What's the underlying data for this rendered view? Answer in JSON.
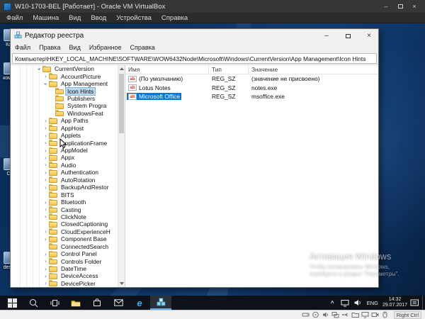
{
  "vbox": {
    "title": "W10-1703-BEL [Работает] - Oracle VM VirtualBox",
    "menu": [
      "Файл",
      "Машина",
      "Вид",
      "Ввод",
      "Устройства",
      "Справка"
    ],
    "status": {
      "hint": "Right Ctrl",
      "icons": [
        "hdd",
        "optical",
        "audio",
        "network",
        "usb",
        "shared-folders",
        "display",
        "recording",
        "mouse-integration"
      ]
    }
  },
  "desktop": {
    "icons": [
      {
        "label": "Ко..."
      },
      {
        "label": "комп..."
      },
      {
        "label": "С..."
      },
      {
        "label": "desk..."
      }
    ]
  },
  "watermark": {
    "title": "Активация Windows",
    "line1": "Чтобы активировать Windows,",
    "line2": "перейдите в раздел \"Параметры\"."
  },
  "regedit": {
    "title": "Редактор реестра",
    "menu": [
      "Файл",
      "Правка",
      "Вид",
      "Избранное",
      "Справка"
    ],
    "address": "Компьютер\\HKEY_LOCAL_MACHINE\\SOFTWARE\\WOW6432Node\\Microsoft\\Windows\\CurrentVersion\\App Management\\Icon Hints",
    "columns": [
      "Имя",
      "Тип",
      "Значение"
    ],
    "tree": [
      {
        "label": "CurrentVersion",
        "indent": 4,
        "state": "expanded",
        "selected": false
      },
      {
        "label": "AccountPicture",
        "indent": 5,
        "state": "collapsed",
        "selected": false
      },
      {
        "label": "App Management",
        "indent": 5,
        "state": "expanded",
        "selected": false
      },
      {
        "label": "Icon Hints",
        "indent": 6,
        "state": "leaf",
        "selected": true
      },
      {
        "label": "Publishers",
        "indent": 6,
        "state": "leaf",
        "selected": false
      },
      {
        "label": "System Progra",
        "indent": 6,
        "state": "leaf",
        "selected": false
      },
      {
        "label": "WindowsFeat",
        "indent": 6,
        "state": "leaf",
        "selected": false
      },
      {
        "label": "App Paths",
        "indent": 5,
        "state": "collapsed",
        "selected": false
      },
      {
        "label": "AppHost",
        "indent": 5,
        "state": "collapsed",
        "selected": false
      },
      {
        "label": "Applets",
        "indent": 5,
        "state": "collapsed",
        "selected": false
      },
      {
        "label": "ApplicationFrame",
        "indent": 5,
        "state": "collapsed",
        "selected": false
      },
      {
        "label": "AppModel",
        "indent": 5,
        "state": "collapsed",
        "selected": false
      },
      {
        "label": "Appx",
        "indent": 5,
        "state": "collapsed",
        "selected": false
      },
      {
        "label": "Audio",
        "indent": 5,
        "state": "collapsed",
        "selected": false
      },
      {
        "label": "Authentication",
        "indent": 5,
        "state": "collapsed",
        "selected": false
      },
      {
        "label": "AutoRotation",
        "indent": 5,
        "state": "collapsed",
        "selected": false
      },
      {
        "label": "BackupAndRestor",
        "indent": 5,
        "state": "collapsed",
        "selected": false
      },
      {
        "label": "BITS",
        "indent": 5,
        "state": "leaf",
        "selected": false
      },
      {
        "label": "Bluetooth",
        "indent": 5,
        "state": "collapsed",
        "selected": false
      },
      {
        "label": "Casting",
        "indent": 5,
        "state": "collapsed",
        "selected": false
      },
      {
        "label": "ClickNote",
        "indent": 5,
        "state": "collapsed",
        "selected": false
      },
      {
        "label": "ClosedCaptioning",
        "indent": 5,
        "state": "leaf",
        "selected": false
      },
      {
        "label": "CloudExperienceH",
        "indent": 5,
        "state": "collapsed",
        "selected": false
      },
      {
        "label": "Component Base",
        "indent": 5,
        "state": "collapsed",
        "selected": false
      },
      {
        "label": "ConnectedSearch",
        "indent": 5,
        "state": "leaf",
        "selected": false
      },
      {
        "label": "Control Panel",
        "indent": 5,
        "state": "collapsed",
        "selected": false
      },
      {
        "label": "Controls Folder",
        "indent": 5,
        "state": "collapsed",
        "selected": false
      },
      {
        "label": "DateTime",
        "indent": 5,
        "state": "collapsed",
        "selected": false
      },
      {
        "label": "DeviceAccess",
        "indent": 5,
        "state": "collapsed",
        "selected": false
      },
      {
        "label": "DevicePicker",
        "indent": 5,
        "state": "collapsed",
        "selected": false
      }
    ],
    "values": [
      {
        "name": "(По умолчанию)",
        "type": "REG_SZ",
        "data": "(значение не присвоено)",
        "selected": false
      },
      {
        "name": "Lotus Notes",
        "type": "REG_SZ",
        "data": "notes.exe",
        "selected": false
      },
      {
        "name": "Microsoft Office",
        "type": "REG_SZ",
        "data": "msoffice.exe",
        "selected": true
      }
    ]
  },
  "taskbar": {
    "icons": [
      "start",
      "search",
      "task-view",
      "file-explorer",
      "store",
      "mail",
      "edge",
      "regedit"
    ],
    "active_icon": "regedit",
    "tray": {
      "icons_left": [
        "chevron-up",
        "network",
        "volume"
      ],
      "icons_right": [
        "notifications"
      ],
      "lang": "ENG",
      "time": "14:32",
      "date": "29.07.2017"
    }
  }
}
